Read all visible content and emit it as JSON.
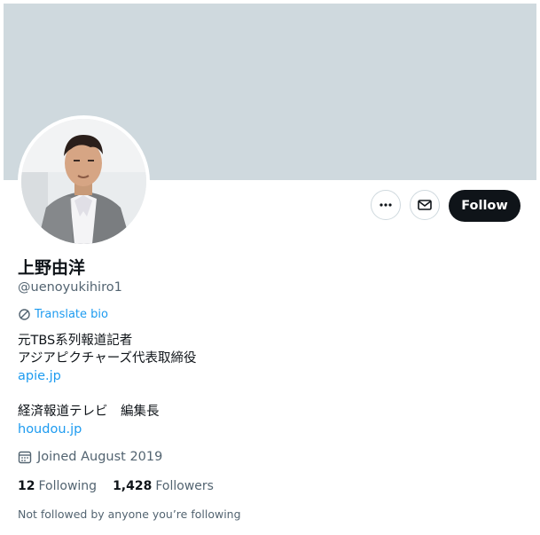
{
  "profile": {
    "name": "上野由洋",
    "handle": "@uenoyukihiro1",
    "translate_label": "Translate bio",
    "bio_lines": [
      "元TBS系列報道記者",
      "アジアピクチャーズ代表取締役"
    ],
    "link1": "apie.jp",
    "bio_line3": "経済報道テレビ　編集長",
    "link2": "houdou.jp",
    "joined": "Joined August 2019",
    "following_count": "12",
    "following_label": "Following",
    "followers_count": "1,428",
    "followers_label": "Followers",
    "not_followed": "Not followed by anyone you’re following"
  },
  "actions": {
    "more_icon": "more-icon",
    "message_icon": "mail-icon",
    "follow_label": "Follow"
  },
  "colors": {
    "banner": "#cfd9de",
    "link": "#1d9bf0",
    "follow_bg": "#0f1419",
    "muted": "#536471"
  }
}
